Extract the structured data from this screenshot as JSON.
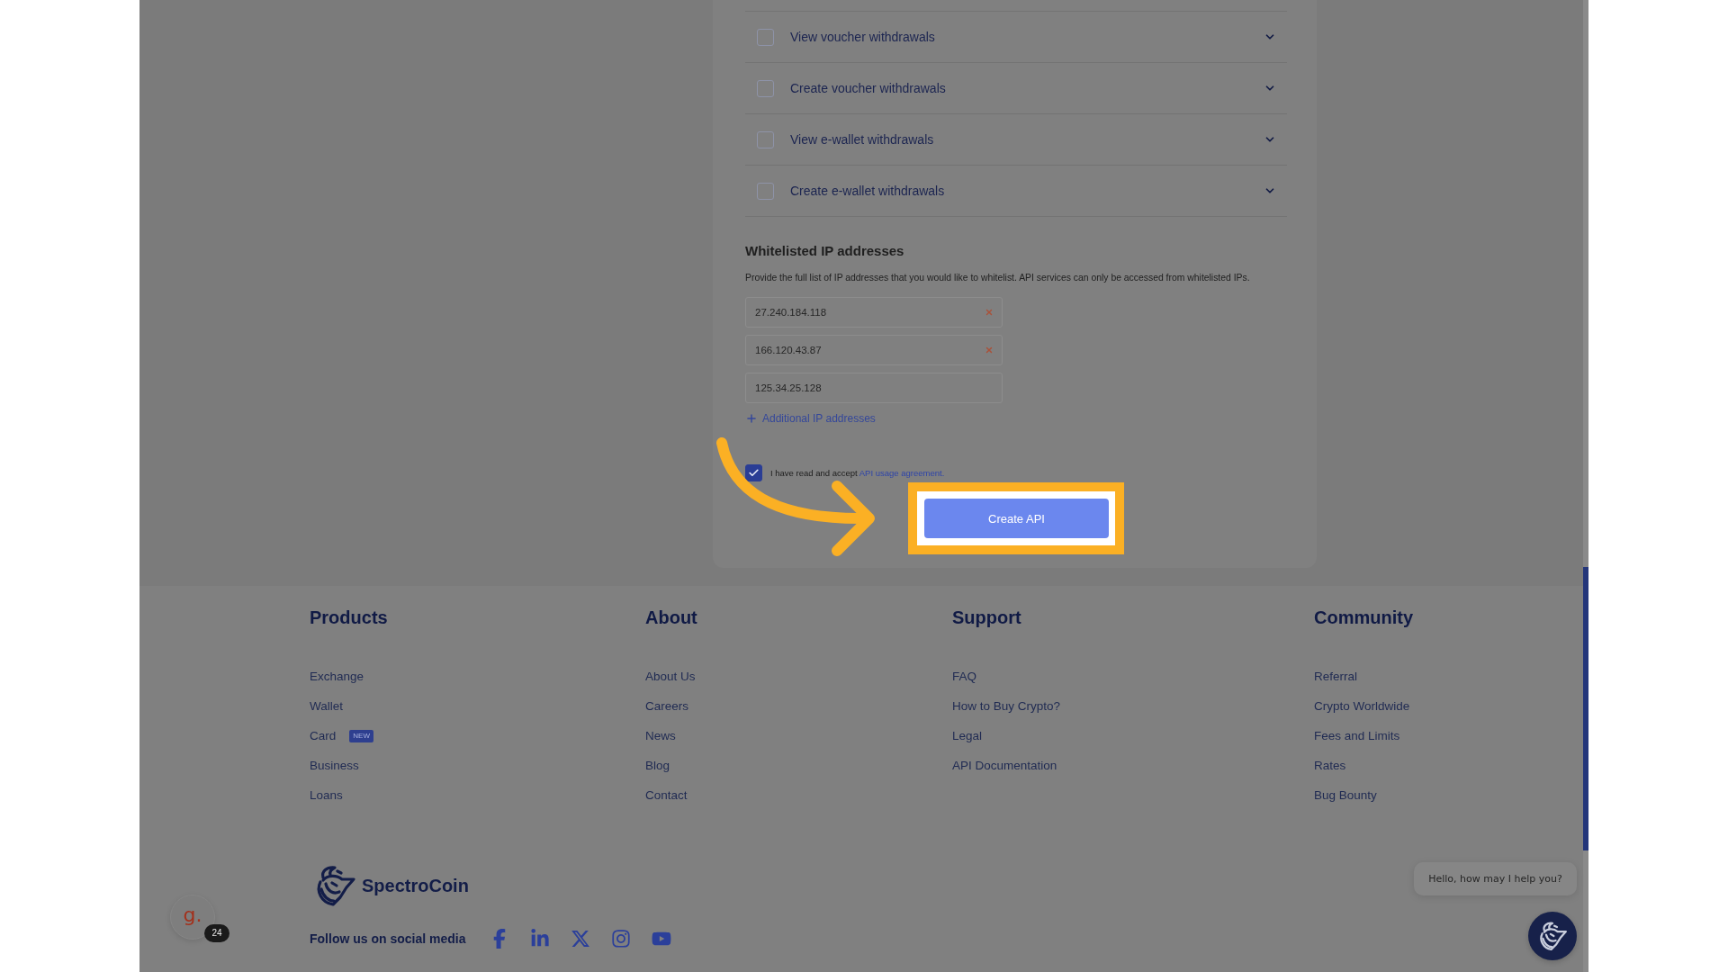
{
  "permissions": [
    {
      "label": "View voucher withdrawals",
      "checked": false,
      "expanded": false
    },
    {
      "label": "Create voucher withdrawals",
      "checked": false,
      "expanded": false
    },
    {
      "label": "View e-wallet withdrawals",
      "checked": false,
      "expanded": false
    },
    {
      "label": "Create e-wallet withdrawals",
      "checked": false,
      "expanded": false
    }
  ],
  "whitelist": {
    "title": "Whitelisted IP addresses",
    "description": "Provide the full list of IP addresses that you would like to whitelist. API services can only be accessed from whitelisted IPs.",
    "ips": [
      {
        "value": "27.240.184.118",
        "removable": true
      },
      {
        "value": "166.120.43.87",
        "removable": true
      },
      {
        "value": "125.34.25.128",
        "removable": false
      }
    ],
    "add_link": "Additional IP addresses"
  },
  "agreement": {
    "checked": true,
    "text": "I have read and accept",
    "link": "API usage agreement."
  },
  "create_button": {
    "label": "Create API",
    "highlighted": true
  },
  "footer": {
    "columns": [
      {
        "title": "Products",
        "links": [
          {
            "label": "Exchange"
          },
          {
            "label": "Wallet"
          },
          {
            "label": "Card",
            "badge": "NEW"
          },
          {
            "label": "Business"
          },
          {
            "label": "Loans"
          }
        ]
      },
      {
        "title": "About",
        "links": [
          {
            "label": "About Us"
          },
          {
            "label": "Careers"
          },
          {
            "label": "News"
          },
          {
            "label": "Blog"
          },
          {
            "label": "Contact"
          }
        ]
      },
      {
        "title": "Support",
        "links": [
          {
            "label": "FAQ"
          },
          {
            "label": "How to Buy Crypto?"
          },
          {
            "label": "Legal"
          },
          {
            "label": "API Documentation"
          }
        ]
      },
      {
        "title": "Community",
        "links": [
          {
            "label": "Referral"
          },
          {
            "label": "Crypto Worldwide"
          },
          {
            "label": "Fees and Limits"
          },
          {
            "label": "Rates"
          },
          {
            "label": "Bug Bounty"
          }
        ]
      }
    ],
    "brand": "SpectroCoin",
    "social_label": "Follow us on social media",
    "social": [
      {
        "kind": "facebook"
      },
      {
        "kind": "linkedin"
      },
      {
        "kind": "x"
      },
      {
        "kind": "instagram"
      },
      {
        "kind": "youtube"
      }
    ]
  },
  "assistant": {
    "logo_text": "g.",
    "count": "24"
  },
  "chat": {
    "greeting": "Hello, how may I help you?"
  }
}
